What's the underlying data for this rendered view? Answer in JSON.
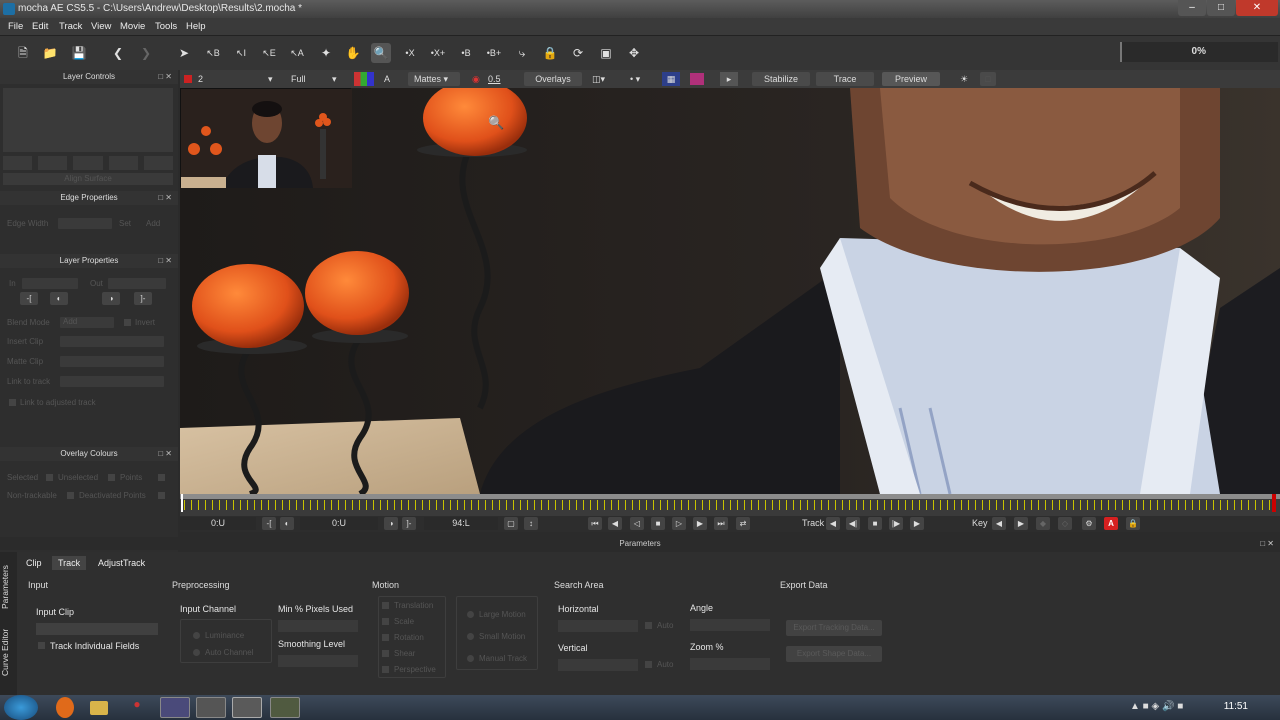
{
  "window": {
    "title": "mocha AE CS5.5 - C:\\Users\\Andrew\\Desktop\\Results\\2.mocha *"
  },
  "menu": [
    "File",
    "Edit",
    "Track",
    "View",
    "Movie",
    "Tools",
    "Help"
  ],
  "toolbar": {
    "progress": "0%"
  },
  "viewer_options": {
    "layer_value": "2",
    "view_value": "Full",
    "channel_label": "A",
    "mattes": "Mattes",
    "opacity": "0.5",
    "overlays": "Overlays",
    "stabilize": "Stabilize",
    "trace": "Trace",
    "preview": "Preview",
    "color_red": "#cc2222",
    "color_magenta": "#b0307a"
  },
  "left_panel": {
    "layer_controls": "Layer Controls",
    "align_surface": "Align Surface",
    "edge_properties": "Edge Properties",
    "edge_width": "Edge Width",
    "edge_set": "Set",
    "edge_add": "Add",
    "layer_properties": "Layer Properties",
    "in": "In",
    "out": "Out",
    "blend_mode": "Blend Mode",
    "blend_value": "Add",
    "invert": "Invert",
    "insert_clip": "Insert Clip",
    "matte_clip": "Matte Clip",
    "link_to_track": "Link to track",
    "link_adjusted": "Link to adjusted track",
    "overlay_colours": "Overlay Colours",
    "selected": "Selected",
    "unselected": "Unselected",
    "points": "Points",
    "non_trackable": "Non-trackable",
    "deactivated_points": "Deactivated Points"
  },
  "transport": {
    "in_time": "0:U",
    "out_time": "0:U",
    "current_frame": "94:L",
    "track_label": "Track",
    "key_label": "Key"
  },
  "parameters_header": "Parameters",
  "bottom": {
    "side_tabs": [
      "Parameters",
      "Curve Editor"
    ],
    "tabs": [
      "Clip",
      "Track",
      "AdjustTrack"
    ],
    "active_tab": "Track",
    "input": {
      "heading": "Input",
      "input_clip": "Input Clip",
      "track_fields": "Track Individual Fields"
    },
    "preprocessing": {
      "heading": "Preprocessing",
      "input_channel": "Input Channel",
      "luminance": "Luminance",
      "auto_channel": "Auto Channel",
      "min_pixels": "Min % Pixels Used",
      "smoothing": "Smoothing Level"
    },
    "motion": {
      "heading": "Motion",
      "options": [
        "Translation",
        "Scale",
        "Rotation",
        "Shear",
        "Perspective"
      ],
      "modes": [
        "Large Motion",
        "Small Motion",
        "Manual Track"
      ]
    },
    "search_area": {
      "heading": "Search Area",
      "horizontal": "Horizontal",
      "vertical": "Vertical",
      "auto": "Auto",
      "angle": "Angle",
      "zoom": "Zoom %"
    },
    "export": {
      "heading": "Export Data",
      "tracking": "Export Tracking Data...",
      "shape": "Export Shape Data..."
    }
  },
  "taskbar": {
    "clock": "11:51"
  }
}
